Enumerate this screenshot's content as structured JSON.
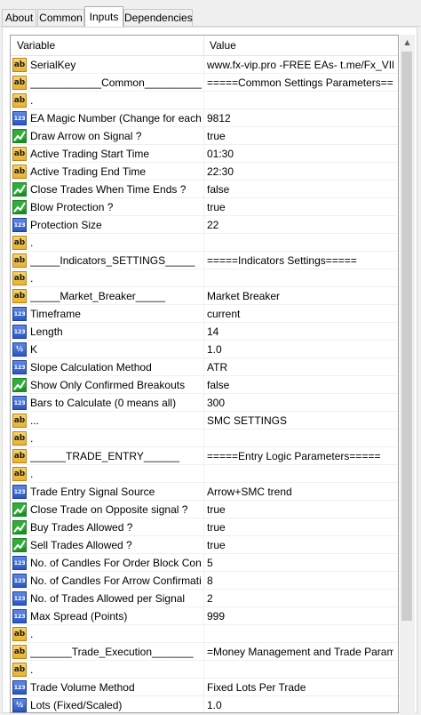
{
  "tabs": [
    {
      "label": "About"
    },
    {
      "label": "Common"
    },
    {
      "label": "Inputs"
    },
    {
      "label": "Dependencies"
    }
  ],
  "grid": {
    "header": {
      "variable": "Variable",
      "value": "Value"
    },
    "rows": [
      {
        "icon": "ab",
        "name": "SerialKey",
        "value": "www.fx-vip.pro   -FREE EAs-   t.me/Fx_VIP"
      },
      {
        "icon": "ab",
        "name": "____________Common____________",
        "value": "=====Common Settings Parameters====="
      },
      {
        "icon": "ab",
        "name": ".",
        "value": ""
      },
      {
        "icon": "num",
        "name": "EA Magic Number (Change for each C...",
        "value": "9812"
      },
      {
        "icon": "bool",
        "name": "Draw Arrow on Signal ?",
        "value": "true"
      },
      {
        "icon": "ab",
        "name": "Active Trading Start Time",
        "value": "01:30"
      },
      {
        "icon": "ab",
        "name": "Active Trading End Time",
        "value": "22:30"
      },
      {
        "icon": "bool",
        "name": "Close Trades When Time Ends ?",
        "value": "false"
      },
      {
        "icon": "bool",
        "name": "Blow Protection ?",
        "value": "true"
      },
      {
        "icon": "num",
        "name": "Protection Size",
        "value": "22"
      },
      {
        "icon": "ab",
        "name": ".",
        "value": ""
      },
      {
        "icon": "ab",
        "name": "_____Indicators_SETTINGS_____",
        "value": "=====Indicators Settings====="
      },
      {
        "icon": "ab",
        "name": ".",
        "value": ""
      },
      {
        "icon": "ab",
        "name": "_____Market_Breaker_____",
        "value": "Market Breaker"
      },
      {
        "icon": "num",
        "name": "Timeframe",
        "value": "current"
      },
      {
        "icon": "num",
        "name": "Length",
        "value": "14"
      },
      {
        "icon": "half",
        "name": "K",
        "value": "1.0"
      },
      {
        "icon": "num",
        "name": "Slope Calculation Method",
        "value": "ATR"
      },
      {
        "icon": "bool",
        "name": "Show Only Confirmed Breakouts",
        "value": "false"
      },
      {
        "icon": "num",
        "name": "Bars to Calculate (0 means all)",
        "value": "300"
      },
      {
        "icon": "ab",
        "name": "...",
        "value": "SMC SETTINGS"
      },
      {
        "icon": "ab",
        "name": ".",
        "value": ""
      },
      {
        "icon": "ab",
        "name": "______TRADE_ENTRY______",
        "value": "=====Entry Logic Parameters====="
      },
      {
        "icon": "ab",
        "name": ".",
        "value": ""
      },
      {
        "icon": "num",
        "name": "Trade Entry Signal Source",
        "value": "Arrow+SMC trend"
      },
      {
        "icon": "bool",
        "name": "Close Trade on Opposite signal ?",
        "value": "true"
      },
      {
        "icon": "bool",
        "name": "Buy Trades Allowed ?",
        "value": "true"
      },
      {
        "icon": "bool",
        "name": "Sell Trades Allowed ?",
        "value": "true"
      },
      {
        "icon": "num",
        "name": "No. of Candles For Order Block Confir...",
        "value": "5"
      },
      {
        "icon": "num",
        "name": "No. of Candles For Arrow Confirmation",
        "value": "8"
      },
      {
        "icon": "num",
        "name": "No. of Trades Allowed per Signal",
        "value": "2"
      },
      {
        "icon": "num",
        "name": "Max Spread (Points)",
        "value": "999"
      },
      {
        "icon": "ab",
        "name": ".",
        "value": ""
      },
      {
        "icon": "ab",
        "name": "_______Trade_Execution_______",
        "value": "=Money Management and Trade Paramet..."
      },
      {
        "icon": "ab",
        "name": ".",
        "value": ""
      },
      {
        "icon": "num",
        "name": "Trade Volume Method",
        "value": "Fixed Lots Per Trade"
      },
      {
        "icon": "half",
        "name": "Lots (Fixed/Scaled)",
        "value": "1.0"
      }
    ]
  },
  "icon_text": {
    "ab": "ab",
    "num": "123",
    "half": "½"
  }
}
